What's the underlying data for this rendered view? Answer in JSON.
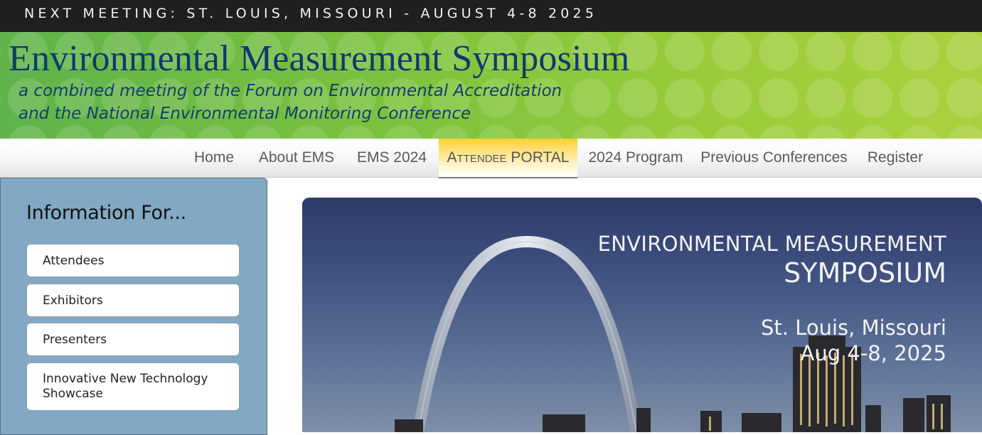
{
  "topbar": {
    "text": "NEXT MEETING: ST. LOUIS, MISSOURI - AUGUST 4-8 2025"
  },
  "banner": {
    "title": "Environmental Measurement Symposium",
    "subtitle_line1": "a combined meeting of the Forum on Environmental Accreditation",
    "subtitle_line2": "and the National Environmental Monitoring Conference"
  },
  "nav": {
    "items": [
      {
        "label": "Home"
      },
      {
        "label": "About EMS"
      },
      {
        "label": "EMS 2024"
      },
      {
        "label_part1": "Attendee",
        "label_part2": "PORTAL",
        "active": true
      },
      {
        "label": "2024 Program"
      },
      {
        "label": "Previous Conferences"
      },
      {
        "label": "Register"
      }
    ]
  },
  "sidebar": {
    "heading": "Information For...",
    "buttons": [
      {
        "label": "Attendees"
      },
      {
        "label": "Exhibitors"
      },
      {
        "label": "Presenters"
      },
      {
        "label": "Innovative New Technology Showcase"
      }
    ]
  },
  "hero": {
    "line1": "ENVIRONMENTAL MEASUREMENT",
    "line2": "SYMPOSIUM",
    "line3": "St. Louis, Missouri",
    "line4": "Aug 4-8, 2025",
    "image": "gateway-arch-skyline-at-dusk"
  },
  "colors": {
    "topbar_bg": "#1f1f1f",
    "banner_green": "#8cc83c",
    "banner_text": "#0f3a6b",
    "nav_active": "#fbcf2c",
    "sidebar_bg": "#82a8c3"
  }
}
